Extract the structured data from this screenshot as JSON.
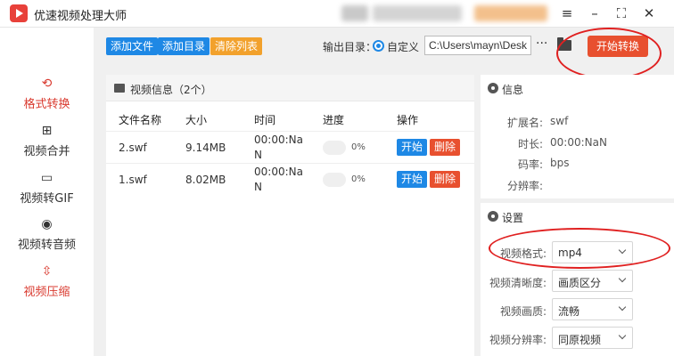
{
  "app": {
    "title": "优速视频处理大师"
  },
  "window": {
    "menu_icon": "hamburger-icon",
    "min_icon": "minimize-icon",
    "max_icon": "fullscreen-icon",
    "close_icon": "close-icon"
  },
  "sidebar": {
    "items": [
      {
        "label": "格式转换",
        "icon": "format-convert-icon",
        "active": true
      },
      {
        "label": "视频合并",
        "icon": "merge-icon"
      },
      {
        "label": "视频转GIF",
        "icon": "gif-icon"
      },
      {
        "label": "视频转音频",
        "icon": "audio-icon"
      },
      {
        "label": "视频压缩",
        "icon": "compress-icon"
      }
    ]
  },
  "toolbar": {
    "add_file": "添加文件",
    "add_dir": "添加目录",
    "clear_list": "清除列表",
    "output_label": "输出目录：",
    "custom_label": "自定义",
    "output_path": "C:\\Users\\mayn\\Desktop",
    "more": "···",
    "start_convert": "开始转换"
  },
  "video_panel": {
    "title": "视频信息（2个）",
    "columns": [
      "文件名称",
      "大小",
      "时间",
      "进度",
      "操作"
    ],
    "rows": [
      {
        "name": "2.swf",
        "size": "9.14MB",
        "time_1": "00:00:Na",
        "time_2": "N",
        "progress_pct": 0,
        "progress": "0%",
        "start": "开始",
        "delete": "删除"
      },
      {
        "name": "1.swf",
        "size": "8.02MB",
        "time_1": "00:00:Na",
        "time_2": "N",
        "progress_pct": 0,
        "progress": "0%",
        "start": "开始",
        "delete": "删除"
      }
    ]
  },
  "info_panel": {
    "title": "信息",
    "ext_key": "扩展名:",
    "ext_val": "swf",
    "dur_key": "时长:",
    "dur_val": "00:00:NaN",
    "bitrate_key": "码率:",
    "bitrate_val": "bps",
    "res_key": "分辨率:",
    "res_val": ""
  },
  "settings_panel": {
    "title": "设置",
    "format_key": "视频格式:",
    "format_val": "mp4",
    "clarity_key": "视频清晰度:",
    "clarity_val": "画质区分",
    "quality_key": "视频画质:",
    "quality_val": "流畅",
    "resolution_key": "视频分辨率:",
    "resolution_val": "同原视频"
  },
  "colors": {
    "accent_blue": "#1e88e5",
    "accent_orange": "#f2a12c",
    "accent_red": "#e8502f",
    "annotation_red": "#e02020"
  }
}
